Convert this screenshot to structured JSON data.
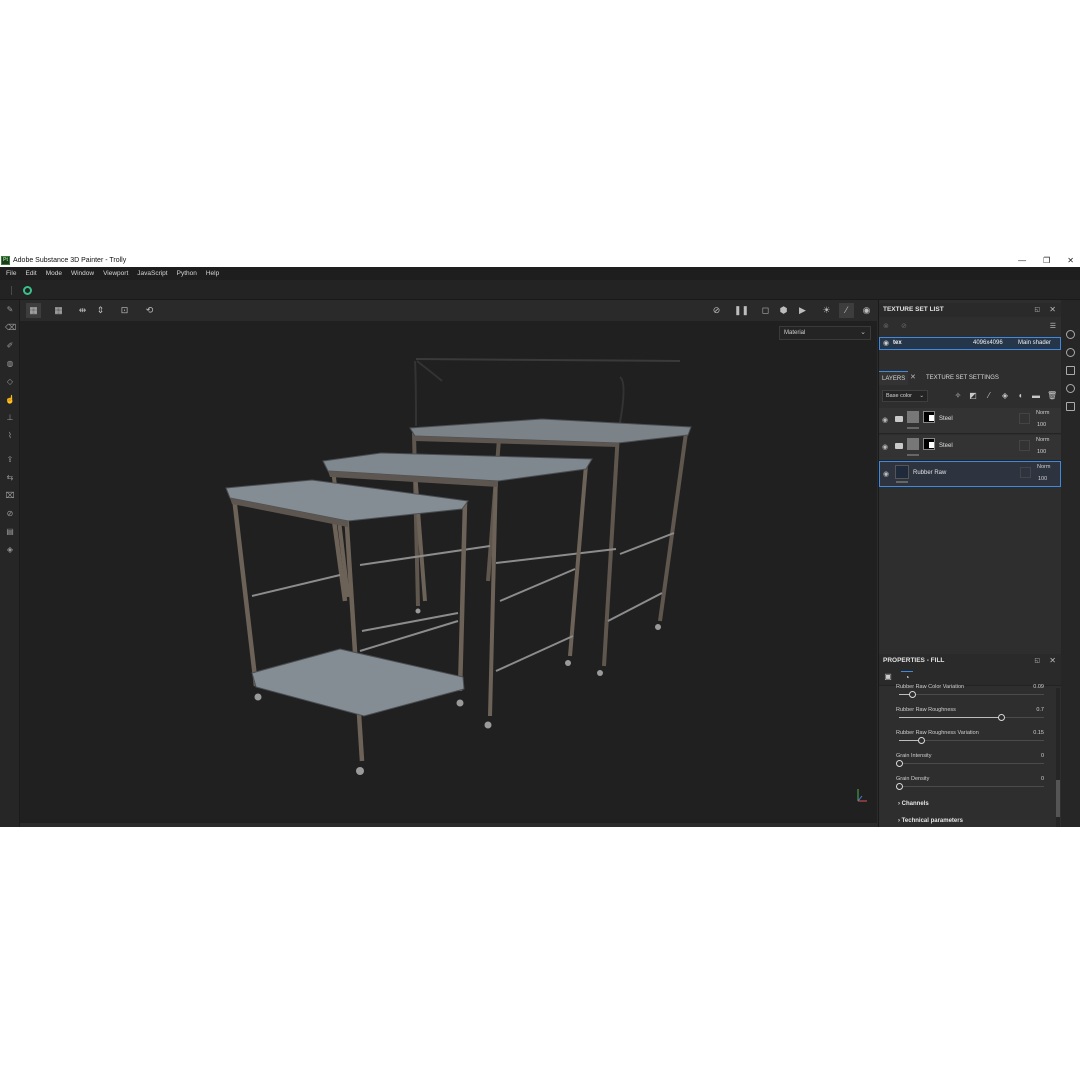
{
  "window": {
    "app_icon": "Pt",
    "title": "Adobe Substance 3D Painter - Trolly",
    "controls": [
      "—",
      "❐",
      "✕"
    ]
  },
  "menu": [
    "File",
    "Edit",
    "Mode",
    "Window",
    "Viewport",
    "JavaScript",
    "Python",
    "Help"
  ],
  "viewport": {
    "material_mode": "Material",
    "axis_labels": {
      "x": "x",
      "y": "y",
      "z": "z"
    }
  },
  "texture_set_list": {
    "title": "TEXTURE SET LIST",
    "row": {
      "name": "tex",
      "resolution": "4096x4096",
      "shader": "Main shader"
    }
  },
  "tabs": {
    "layers": "LAYERS",
    "settings": "TEXTURE SET SETTINGS"
  },
  "layers_toolbar": {
    "channel": "Base color"
  },
  "layers": [
    {
      "name": "Steel",
      "blend": "Norm",
      "opacity": "100"
    },
    {
      "name": "Steel",
      "blend": "Norm",
      "opacity": "100"
    },
    {
      "name": "Rubber Raw",
      "blend": "Norm",
      "opacity": "100"
    }
  ],
  "properties": {
    "title": "PROPERTIES - FILL",
    "params": [
      {
        "label": "Rubber Raw Color Variation",
        "value": "0.09",
        "level": 0.09
      },
      {
        "label": "Rubber Raw Roughness",
        "value": "0.7",
        "level": 0.7
      },
      {
        "label": "Rubber Raw Roughness Variation",
        "value": "0.15",
        "level": 0.15
      },
      {
        "label": "Grain Intensity",
        "value": "0",
        "level": 0
      },
      {
        "label": "Grain Density",
        "value": "0",
        "level": 0
      }
    ],
    "sections": [
      "Channels",
      "Technical parameters"
    ]
  },
  "colors": {
    "accent": "#3f8ae0",
    "bg": "#2b2b2b",
    "viewport": "#202020",
    "brand": "#39c18b"
  }
}
